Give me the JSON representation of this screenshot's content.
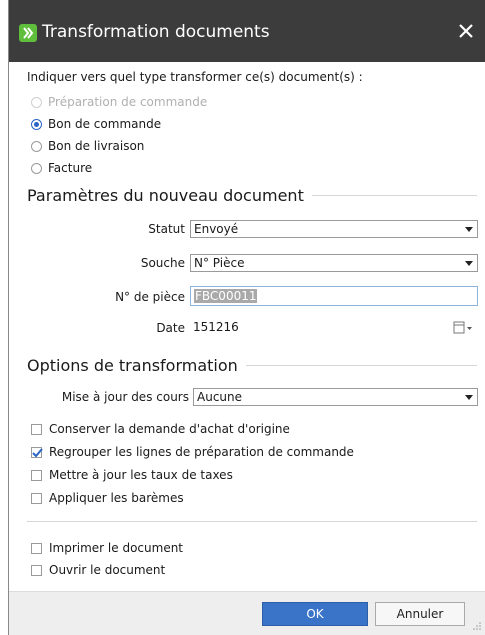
{
  "window": {
    "title": "Transformation documents",
    "accent_color": "#3a74c8",
    "titlebar_color": "#3c3c3c"
  },
  "intro": "Indiquer vers quel type transformer ce(s) document(s) :",
  "doc_types": [
    {
      "label": "Préparation de commande",
      "checked": false,
      "disabled": true
    },
    {
      "label": "Bon de commande",
      "checked": true,
      "disabled": false
    },
    {
      "label": "Bon de livraison",
      "checked": false,
      "disabled": false
    },
    {
      "label": "Facture",
      "checked": false,
      "disabled": false
    }
  ],
  "params": {
    "header": "Paramètres du nouveau document",
    "statut_label": "Statut",
    "statut_value": "Envoyé",
    "souche_label": "Souche",
    "souche_value": "N° Pièce",
    "piece_label": "N° de pièce",
    "piece_value": "FBC00011",
    "date_label": "Date",
    "date_value": "151216"
  },
  "options": {
    "header": "Options de transformation",
    "cours_label": "Mise à jour des cours",
    "cours_value": "Aucune",
    "checks": [
      {
        "label": "Conserver la demande d'achat d'origine",
        "checked": false
      },
      {
        "label": "Regrouper les lignes de préparation de commande",
        "checked": true
      },
      {
        "label": "Mettre à jour les taux de taxes",
        "checked": false
      },
      {
        "label": "Appliquer les barèmes",
        "checked": false
      }
    ],
    "print_checks": [
      {
        "label": "Imprimer le document",
        "checked": false
      },
      {
        "label": "Ouvrir le document",
        "checked": false
      }
    ]
  },
  "footer": {
    "ok_label": "OK",
    "cancel_label": "Annuler"
  }
}
